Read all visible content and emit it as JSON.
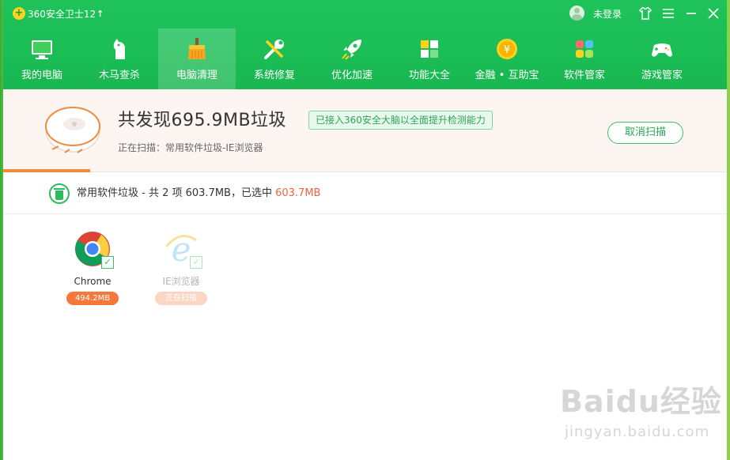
{
  "window": {
    "app_title": "360安全卫士12",
    "login_label": "未登录"
  },
  "nav": [
    {
      "label": "我的电脑",
      "icon": "monitor-icon",
      "active": false
    },
    {
      "label": "木马查杀",
      "icon": "trojan-horse-icon",
      "active": false
    },
    {
      "label": "电脑清理",
      "icon": "broom-icon",
      "active": true
    },
    {
      "label": "系统修复",
      "icon": "wrench-icon",
      "active": false
    },
    {
      "label": "优化加速",
      "icon": "rocket-icon",
      "active": false
    },
    {
      "label": "功能大全",
      "icon": "grid-icon",
      "active": false
    },
    {
      "label": "金融 • 互助宝",
      "icon": "coin-icon",
      "active": false
    },
    {
      "label": "软件管家",
      "icon": "apps-icon",
      "active": false
    },
    {
      "label": "游戏管家",
      "icon": "gamepad-icon",
      "active": false
    }
  ],
  "scan": {
    "title": "共发现695.9MB垃圾",
    "ai_badge": "已接入360安全大脑以全面提升检测能力",
    "status": "正在扫描：常用软件垃圾-IE浏览器",
    "cancel_label": "取消扫描",
    "progress": 0.12
  },
  "category": {
    "summary": "常用软件垃圾 - 共 2 项 603.7MB，已选中 ",
    "selected_size": "603.7MB"
  },
  "items": [
    {
      "name": "Chrome",
      "size": "494.2MB",
      "checked": true
    },
    {
      "name": "IE浏览器",
      "size": "正在扫描",
      "checked": true
    }
  ],
  "watermark": {
    "main": "Baidu经验",
    "sub": "jingyan.baidu.com"
  },
  "colors": {
    "brand_green": "#1fc35a",
    "accent_orange": "#f5773a",
    "highlight_red": "#f0643c"
  }
}
